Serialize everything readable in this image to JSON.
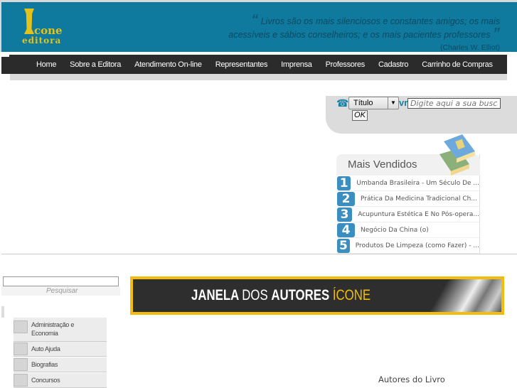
{
  "header": {
    "logo_main": "cone",
    "logo_sub": "editora",
    "quote": "Livros são os mais silenciosos e constantes amigos; os mais acessíveis e sábios conselheiros; e os mais pacientes professores",
    "quote_author": "(Charles W. Elliot)"
  },
  "nav": [
    "Home",
    "Sobre a Editora",
    "Atendimento On-line",
    "Representantes",
    "Imprensa",
    "Professores",
    "Cadastro",
    "Carrinho de Compras"
  ],
  "search": {
    "select_value": "Título",
    "partial_text": "vr",
    "placeholder": "Digite aqui a sua busca",
    "ok_label": "OK"
  },
  "mais_vendidos": {
    "title": "Mais Vendidos",
    "items": [
      {
        "rank": "1",
        "title": "Umbanda Brasileira - Um Século De ..."
      },
      {
        "rank": "2",
        "title": "Prática Da Medicina Tradicional Ch..."
      },
      {
        "rank": "3",
        "title": "Acupuntura Estética E No Pós-opera..."
      },
      {
        "rank": "4",
        "title": "Negócio Da China (o)"
      },
      {
        "rank": "5",
        "title": "Produtos De Limpeza (como Fazer) - ..."
      }
    ]
  },
  "sidebar": {
    "search_label": "Pesquisar",
    "categories": [
      "Administração e Economia",
      "Auto Ajuda",
      "Biografias",
      "Concursos"
    ]
  },
  "banner": {
    "w1": "JANELA ",
    "w2": "DOS ",
    "w3": "AUTORES ",
    "w4": "ÍCONE"
  },
  "autores_label": "Autores do Livro"
}
